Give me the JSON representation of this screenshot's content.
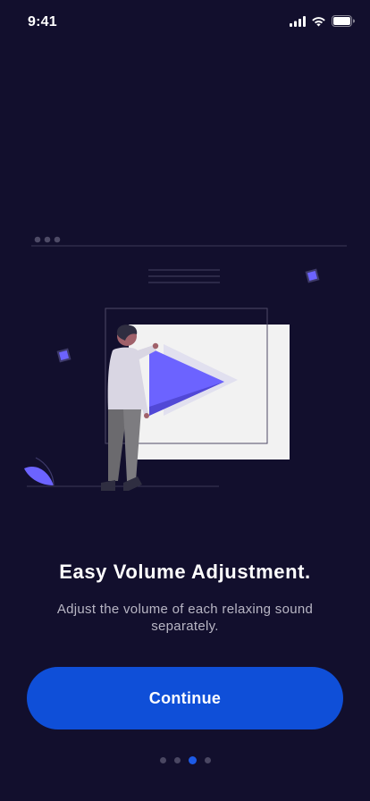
{
  "status_bar": {
    "time": "9:41",
    "icons": [
      "cellular-signal-icon",
      "wifi-icon",
      "battery-icon"
    ]
  },
  "illustration": {
    "description_icon": "person-video-player-illustration",
    "accent_color": "#6c63ff"
  },
  "onboarding": {
    "title": "Easy Volume Adjustment.",
    "subtitle": "Adjust the volume of each relaxing sound separately.",
    "continue_label": "Continue"
  },
  "pager": {
    "total": 4,
    "active_index": 2
  },
  "colors": {
    "background": "#120f2d",
    "primary_button": "#0f4fd8",
    "active_dot": "#1d5be6",
    "inactive_dot": "#4a4762"
  }
}
